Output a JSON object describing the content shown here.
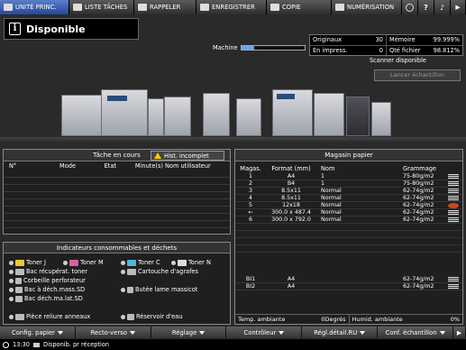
{
  "tabs": [
    {
      "label": "UNITÉ PRINC."
    },
    {
      "label": "LISTE TÂCHES"
    },
    {
      "label": "RAPPELER"
    },
    {
      "label": "ENREGISTRER"
    },
    {
      "label": "COPIE"
    },
    {
      "label": "NUMÉRISATION"
    }
  ],
  "status": {
    "title": "Disponible",
    "icon": "i"
  },
  "counters": {
    "originals_label": "Originaux",
    "originals_value": "30",
    "memory_label": "Mémoire",
    "memory_value": "99.999%",
    "printing_label": "En impress.",
    "printing_value": "0",
    "file_label": "Qté fichier",
    "file_value": "98.812%"
  },
  "machine": {
    "label": "Machine",
    "progress": 0.2
  },
  "scanner": {
    "status": "Scanner disponible",
    "sample_button": "Lancer échantillon"
  },
  "jobs": {
    "title": "Tâche en cours",
    "warning_button": "Hist. incomplet",
    "columns": [
      "N°",
      "Mode",
      "Etat",
      "Minute(s)",
      "Nom utilisateur"
    ]
  },
  "consumables": {
    "title": "Indicateurs consommables et déchets",
    "items": [
      "Toner J",
      "Toner M",
      "Toner C",
      "Toner N",
      "Bac récupérat. toner",
      "Cartouche d'agrafes",
      "Corbeille perforateur",
      "Bac à déch.mass.SD",
      "Butée lame massicot",
      "Bac déch.ma.lat.SD",
      "Pièce reliure anneaux",
      "Réservoir d'eau"
    ]
  },
  "paper": {
    "title": "Magasin papier",
    "columns": [
      "Magas.",
      "Format (mm)",
      "Nom",
      "Grammage"
    ],
    "rows": [
      {
        "tray": "1",
        "format": "A4",
        "name": "1",
        "weight": "75-80g/m2"
      },
      {
        "tray": "2",
        "format": "B4",
        "name": "1",
        "weight": "75-80g/m2"
      },
      {
        "tray": "3",
        "format": "8.5x11",
        "name": "Normal",
        "weight": "62-74g/m2"
      },
      {
        "tray": "4",
        "format": "8.5x11",
        "name": "Normal",
        "weight": "62-74g/m2"
      },
      {
        "tray": "5",
        "format": "12x18",
        "name": "Normal",
        "weight": "62-74g/m2"
      },
      {
        "tray": "←",
        "format": "300.0 x 487.4",
        "name": "Normal",
        "weight": "62-74g/m2"
      },
      {
        "tray": "6",
        "format": "300.0 x 792.0",
        "name": "Normal",
        "weight": "62-74g/m2"
      }
    ],
    "bypass": [
      {
        "tray": "BI1",
        "format": "A4",
        "weight": "62-74g/m2"
      },
      {
        "tray": "BI2",
        "format": "A4",
        "weight": "62-74g/m2"
      }
    ],
    "temp_label": "Temp. ambiante",
    "temp_value": "0Degrés",
    "hum_label": "Humid. ambiante",
    "hum_value": "0%"
  },
  "bottom": [
    "Config. papier",
    "Recto-verso",
    "Réglage",
    "Contrôleur",
    "Régl.détail.RU",
    "Conf. échantillon"
  ],
  "statusbar": {
    "time": "13:30",
    "message": "Disponib. pr réception"
  }
}
